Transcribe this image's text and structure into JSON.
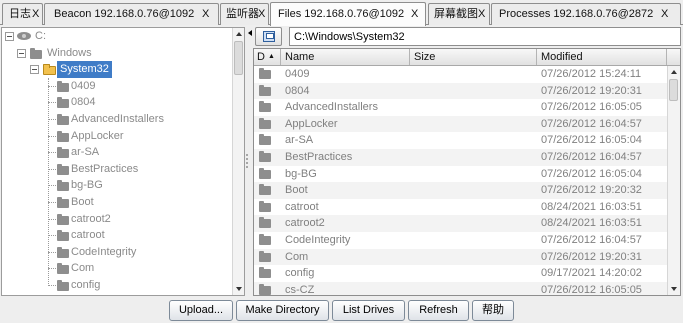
{
  "tabs": [
    {
      "label": "日志",
      "close": "X"
    },
    {
      "label": "Beacon 192.168.0.76@1092",
      "close": "X"
    },
    {
      "label": "监听器",
      "close": "X"
    },
    {
      "label": "Files 192.168.0.76@1092",
      "close": "X",
      "active": true
    },
    {
      "label": "屏幕截图",
      "close": "X"
    },
    {
      "label": "Processes 192.168.0.76@2872",
      "close": "X"
    }
  ],
  "tree": {
    "root": {
      "label": "C:",
      "icon": "drive-icon",
      "expanded": true
    },
    "windows": {
      "label": "Windows",
      "icon": "folder-icon",
      "expanded": true
    },
    "system32": {
      "label": "System32",
      "icon": "folder-open-icon",
      "expanded": true,
      "selected": true
    },
    "children": [
      "0409",
      "0804",
      "AdvancedInstallers",
      "AppLocker",
      "ar-SA",
      "BestPractices",
      "bg-BG",
      "Boot",
      "catroot2",
      "catroot",
      "CodeIntegrity",
      "Com",
      "config"
    ]
  },
  "path": {
    "value": "C:\\Windows\\System32",
    "up_button_icon": "parent-folder-icon"
  },
  "table": {
    "columns": {
      "type": "D",
      "name": "Name",
      "size": "Size",
      "modified": "Modified"
    },
    "sort_indicator": "▲",
    "rows": [
      {
        "icon": "folder-icon",
        "name": "0409",
        "size": "",
        "modified": "07/26/2012 15:24:11"
      },
      {
        "icon": "folder-icon",
        "name": "0804",
        "size": "",
        "modified": "07/26/2012 19:20:31"
      },
      {
        "icon": "folder-icon",
        "name": "AdvancedInstallers",
        "size": "",
        "modified": "07/26/2012 16:05:05"
      },
      {
        "icon": "folder-icon",
        "name": "AppLocker",
        "size": "",
        "modified": "07/26/2012 16:04:57"
      },
      {
        "icon": "folder-icon",
        "name": "ar-SA",
        "size": "",
        "modified": "07/26/2012 16:05:04"
      },
      {
        "icon": "folder-icon",
        "name": "BestPractices",
        "size": "",
        "modified": "07/26/2012 16:04:57"
      },
      {
        "icon": "folder-icon",
        "name": "bg-BG",
        "size": "",
        "modified": "07/26/2012 16:05:04"
      },
      {
        "icon": "folder-icon",
        "name": "Boot",
        "size": "",
        "modified": "07/26/2012 19:20:32"
      },
      {
        "icon": "folder-icon",
        "name": "catroot",
        "size": "",
        "modified": "08/24/2021 16:03:51"
      },
      {
        "icon": "folder-icon",
        "name": "catroot2",
        "size": "",
        "modified": "08/24/2021 16:03:51"
      },
      {
        "icon": "folder-icon",
        "name": "CodeIntegrity",
        "size": "",
        "modified": "07/26/2012 16:04:57"
      },
      {
        "icon": "folder-icon",
        "name": "Com",
        "size": "",
        "modified": "07/26/2012 19:20:31"
      },
      {
        "icon": "folder-icon",
        "name": "config",
        "size": "",
        "modified": "09/17/2021 14:20:02"
      },
      {
        "icon": "folder-icon",
        "name": "cs-CZ",
        "size": "",
        "modified": "07/26/2012 16:05:05"
      }
    ]
  },
  "buttons": {
    "upload": "Upload...",
    "make_directory": "Make Directory",
    "list_drives": "List Drives",
    "refresh": "Refresh",
    "help": "帮助"
  },
  "colors": {
    "selection": "#3f7cc7",
    "muted_text": "#808080",
    "open_folder": "#f2c14e",
    "folder": "#8e8e8e",
    "window_bg": "#eeeeee"
  }
}
